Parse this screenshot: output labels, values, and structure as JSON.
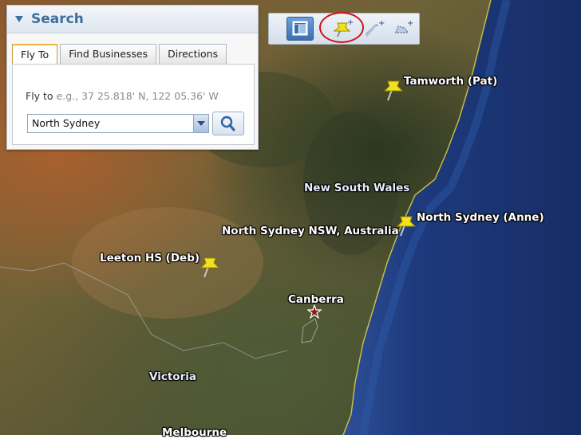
{
  "search_panel": {
    "title": "Search",
    "tabs": [
      {
        "label": "Fly To",
        "active": true
      },
      {
        "label": "Find Businesses",
        "active": false
      },
      {
        "label": "Directions",
        "active": false
      }
    ],
    "fly_to_prefix": "Fly to ",
    "fly_to_example": "e.g., 37 25.818' N, 122 05.36' W",
    "location_value": "North Sydney"
  },
  "toolbar": {
    "tools": [
      {
        "icon": "sidebar-toggle-icon",
        "active": true
      },
      {
        "icon": "add-placemark-icon",
        "active": false,
        "highlighted": true
      },
      {
        "icon": "add-path-icon",
        "active": false
      },
      {
        "icon": "add-polygon-icon",
        "active": false
      }
    ]
  },
  "map": {
    "placemarks": [
      {
        "label": "Tamworth (Pat)"
      },
      {
        "label": "North Sydney (Anne)"
      },
      {
        "label": "Leeton HS (Deb)"
      }
    ],
    "capital": "Canberra",
    "search_result": "North Sydney NSW, Australia",
    "regions": [
      "New South Wales",
      "Victoria",
      "Melbourne"
    ]
  },
  "colors": {
    "ocean": "#1d3577",
    "land": "#6a5b3a",
    "panel_title": "#3d6e9e",
    "highlight_ring": "#d0111b",
    "placemark": "#f2e21e"
  }
}
